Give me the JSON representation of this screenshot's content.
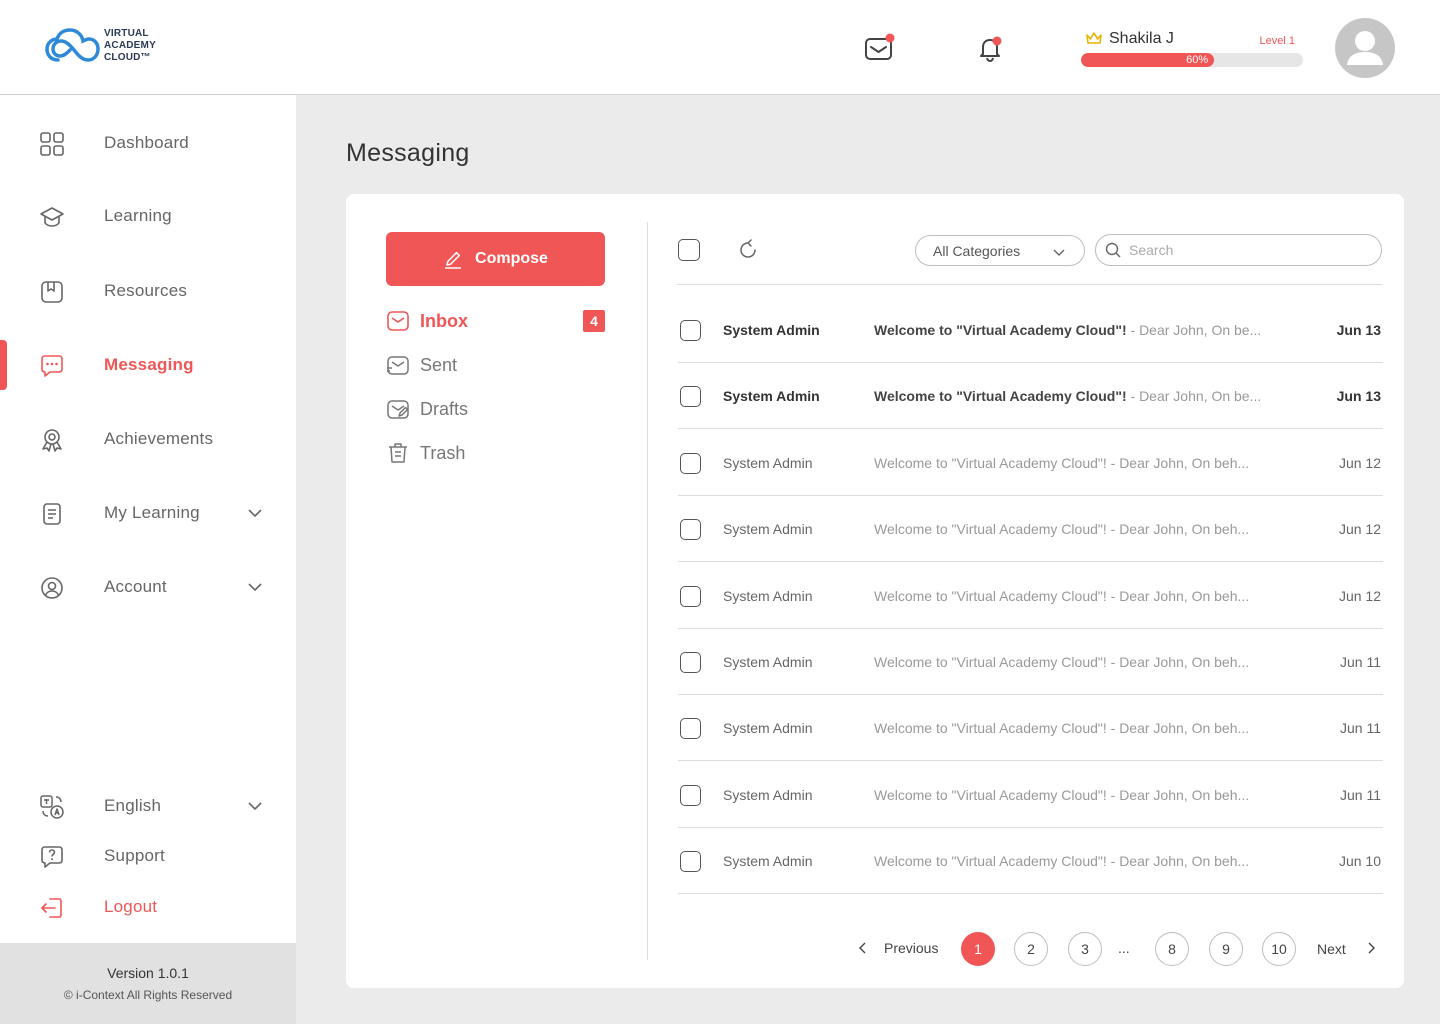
{
  "brand": {
    "name_lines": [
      "VIRTUAL",
      "ACADEMY",
      "CLOUD™"
    ]
  },
  "header": {
    "user_name": "Shakila J",
    "level": "Level 1",
    "progress_text": "60%",
    "progress_fraction": 0.6
  },
  "colors": {
    "accent": "#f05656",
    "badge_dot": "#f05656"
  },
  "sidebar": {
    "items": [
      {
        "label": "Dashboard",
        "icon": "grid-icon"
      },
      {
        "label": "Learning",
        "icon": "graduation-cap-icon"
      },
      {
        "label": "Resources",
        "icon": "bookmark-book-icon"
      },
      {
        "label": "Messaging",
        "icon": "chat-bubble-icon",
        "active": true
      },
      {
        "label": "Achievements",
        "icon": "award-icon"
      },
      {
        "label": "My Learning",
        "icon": "notebook-icon"
      },
      {
        "label": "Account",
        "icon": "user-circle-icon"
      }
    ],
    "bottom": [
      {
        "label": "English",
        "icon": "translate-icon"
      },
      {
        "label": "Support",
        "icon": "help-bubble-icon"
      },
      {
        "label": "Logout",
        "icon": "logout-icon"
      }
    ],
    "version": "Version 1.0.1",
    "copyright": "© i-Context All Rights Reserved"
  },
  "main": {
    "title": "Messaging",
    "compose_label": "Compose",
    "folders": [
      {
        "label": "Inbox",
        "badge": "4",
        "icon": "inbox-icon"
      },
      {
        "label": "Sent",
        "icon": "sent-icon"
      },
      {
        "label": "Drafts",
        "icon": "drafts-icon"
      },
      {
        "label": "Trash",
        "icon": "trash-icon"
      }
    ],
    "category_select": "All Categories",
    "search_placeholder": "Search",
    "messages": [
      {
        "sender": "System Admin",
        "subject": "Welcome to \"Virtual Academy Cloud\"!",
        "preview": " - Dear John, On be...",
        "date": "Jun 13",
        "unread": true
      },
      {
        "sender": "System Admin",
        "subject": "Welcome to \"Virtual Academy Cloud\"!",
        "preview": " - Dear John, On be...",
        "date": "Jun 13",
        "unread": true
      },
      {
        "sender": "System Admin",
        "subject": "Welcome to \"Virtual Academy Cloud\"!",
        "preview": " - Dear John, On beh...",
        "date": "Jun 12",
        "unread": false
      },
      {
        "sender": "System Admin",
        "subject": "Welcome to \"Virtual Academy Cloud\"!",
        "preview": " - Dear John, On beh...",
        "date": "Jun 12",
        "unread": false
      },
      {
        "sender": "System Admin",
        "subject": "Welcome to \"Virtual Academy Cloud\"!",
        "preview": " - Dear John, On beh...",
        "date": "Jun 12",
        "unread": false
      },
      {
        "sender": "System Admin",
        "subject": "Welcome to \"Virtual Academy Cloud\"!",
        "preview": " - Dear John, On beh...",
        "date": "Jun 11",
        "unread": false
      },
      {
        "sender": "System Admin",
        "subject": "Welcome to \"Virtual Academy Cloud\"!",
        "preview": " - Dear John, On beh...",
        "date": "Jun 11",
        "unread": false
      },
      {
        "sender": "System Admin",
        "subject": "Welcome to \"Virtual Academy Cloud\"!",
        "preview": " - Dear John, On beh...",
        "date": "Jun 11",
        "unread": false
      },
      {
        "sender": "System Admin",
        "subject": "Welcome to \"Virtual Academy Cloud\"!",
        "preview": " - Dear John, On beh...",
        "date": "Jun 10",
        "unread": false
      }
    ],
    "pagination": {
      "previous": "Previous",
      "next": "Next",
      "pages": [
        "1",
        "2",
        "3",
        "...",
        "8",
        "9",
        "10"
      ],
      "current": "1"
    }
  }
}
